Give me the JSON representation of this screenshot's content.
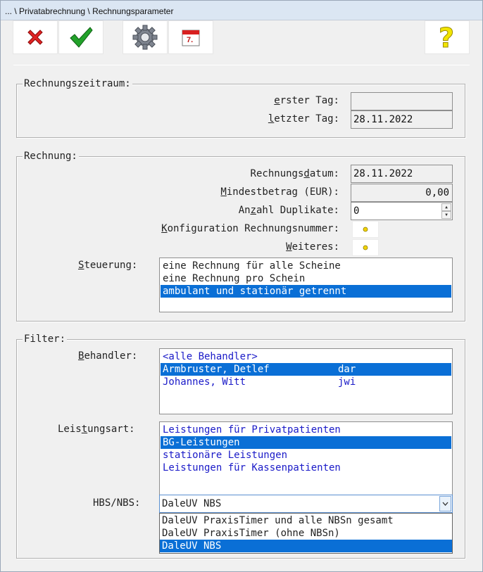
{
  "window": {
    "title": "... \\ Privatabrechnung \\ Rechnungsparameter"
  },
  "toolbar": {
    "cancel_icon": "red-x-icon",
    "ok_icon": "green-check-icon",
    "settings_icon": "gear-icon",
    "calendar_icon": "calendar-icon",
    "calendar_text": "7.",
    "help_icon": "question-mark-icon",
    "help_text": "?"
  },
  "rechnungszeitraum": {
    "legend": "Rechnungszeitraum:",
    "erster_tag_label_u": "e",
    "erster_tag_label_rest": "rster Tag:",
    "erster_tag_value": "",
    "letzter_tag_label_u": "l",
    "letzter_tag_label_rest": "etzter Tag:",
    "letzter_tag_value": "28.11.2022"
  },
  "rechnung": {
    "legend": "Rechnung:",
    "datum_label_pre": "Rechnungs",
    "datum_label_u": "d",
    "datum_label_rest": "atum:",
    "datum_value": "28.11.2022",
    "mindest_label_u": "M",
    "mindest_label_rest": "indestbetrag (EUR):",
    "mindest_value": "0,00",
    "duplikate_label_pre": "An",
    "duplikate_label_u": "z",
    "duplikate_label_rest": "ahl Duplikate:",
    "duplikate_value": "0",
    "konfig_label_u": "K",
    "konfig_label_rest": "onfiguration Rechnungsnummer:",
    "weiteres_label_u": "W",
    "weiteres_label_rest": "eiteres:",
    "steuerung_label_u": "S",
    "steuerung_label_rest": "teuerung:",
    "steuerung_options": [
      "eine Rechnung für alle Scheine",
      "eine Rechnung pro Schein",
      "ambulant und stationär getrennt"
    ]
  },
  "filter": {
    "legend": "Filter:",
    "behandler_label_u": "B",
    "behandler_label_rest": "ehandler:",
    "behandler_items": [
      {
        "name": "<alle Behandler>",
        "code": ""
      },
      {
        "name": "Armbruster, Detlef",
        "code": "dar"
      },
      {
        "name": "Johannes, Witt",
        "code": "jwi"
      }
    ],
    "leistungsart_label_pre": "Leis",
    "leistungsart_label_u": "t",
    "leistungsart_label_rest": "ungsart:",
    "leistungsart_items": [
      "Leistungen für Privatpatienten",
      "BG-Leistungen",
      "stationäre Leistungen",
      "Leistungen für Kassenpatienten"
    ],
    "hbs_label": "HBS/NBS:",
    "hbs_value": "DaleUV NBS",
    "hbs_options": [
      "DaleUV PraxisTimer und alle NBSn gesamt",
      "DaleUV PraxisTimer (ohne NBSn)",
      "DaleUV NBS"
    ]
  },
  "colors": {
    "selection": "#0a6fd6",
    "list_text_blue": "#1a1ac8",
    "background": "#f0f0f0"
  }
}
